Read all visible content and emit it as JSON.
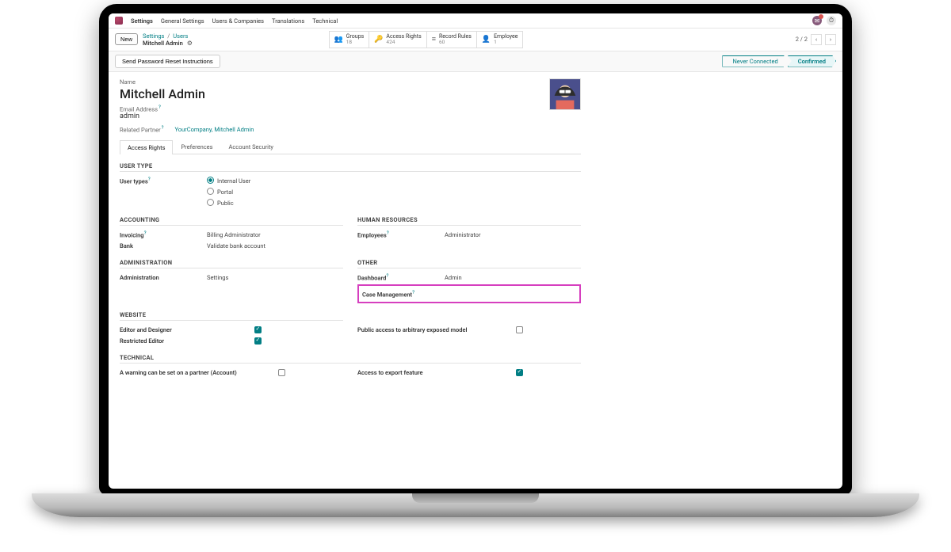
{
  "menu": {
    "app": "Settings",
    "items": [
      "General Settings",
      "Users & Companies",
      "Translations",
      "Technical"
    ]
  },
  "ctrl": {
    "new": "New",
    "crumb_parent": "Settings",
    "crumb_section": "Users",
    "crumb_current": "Mitchell Admin",
    "pager": "2 / 2"
  },
  "stats": [
    {
      "icon": "👥",
      "label": "Groups",
      "count": "18"
    },
    {
      "icon": "🔑",
      "label": "Access Rights",
      "count": "424"
    },
    {
      "icon": "≡",
      "label": "Record Rules",
      "count": "60"
    },
    {
      "icon": "👤",
      "label": "Employee",
      "count": "1"
    }
  ],
  "action": {
    "send_reset": "Send Password Reset Instructions",
    "status_never": "Never Connected",
    "status_confirmed": "Confirmed"
  },
  "head": {
    "name_label": "Name",
    "name": "Mitchell Admin",
    "email_label": "Email Address",
    "email": "admin",
    "partner_label": "Related Partner",
    "partner": "YourCompany, Mitchell Admin"
  },
  "tabs": [
    "Access Rights",
    "Preferences",
    "Account Security"
  ],
  "user_type": {
    "section": "USER TYPE",
    "label": "User types",
    "options": [
      "Internal User",
      "Portal",
      "Public"
    ]
  },
  "accounting": {
    "section": "ACCOUNTING",
    "invoicing_label": "Invoicing",
    "invoicing_value": "Billing Administrator",
    "bank_label": "Bank",
    "bank_value": "Validate bank account"
  },
  "hr": {
    "section": "HUMAN RESOURCES",
    "employees_label": "Employees",
    "employees_value": "Administrator"
  },
  "administration": {
    "section": "ADMINISTRATION",
    "label": "Administration",
    "value": "Settings"
  },
  "other": {
    "section": "OTHER",
    "dashboard_label": "Dashboard",
    "dashboard_value": "Admin",
    "case_label": "Case Management"
  },
  "website": {
    "section": "WEBSITE",
    "editor_label": "Editor and Designer",
    "restricted_label": "Restricted Editor",
    "public_label": "Public access to arbitrary exposed model"
  },
  "technical": {
    "section": "TECHNICAL",
    "warning_label": "A warning can be set on a partner (Account)",
    "export_label": "Access to export feature"
  }
}
